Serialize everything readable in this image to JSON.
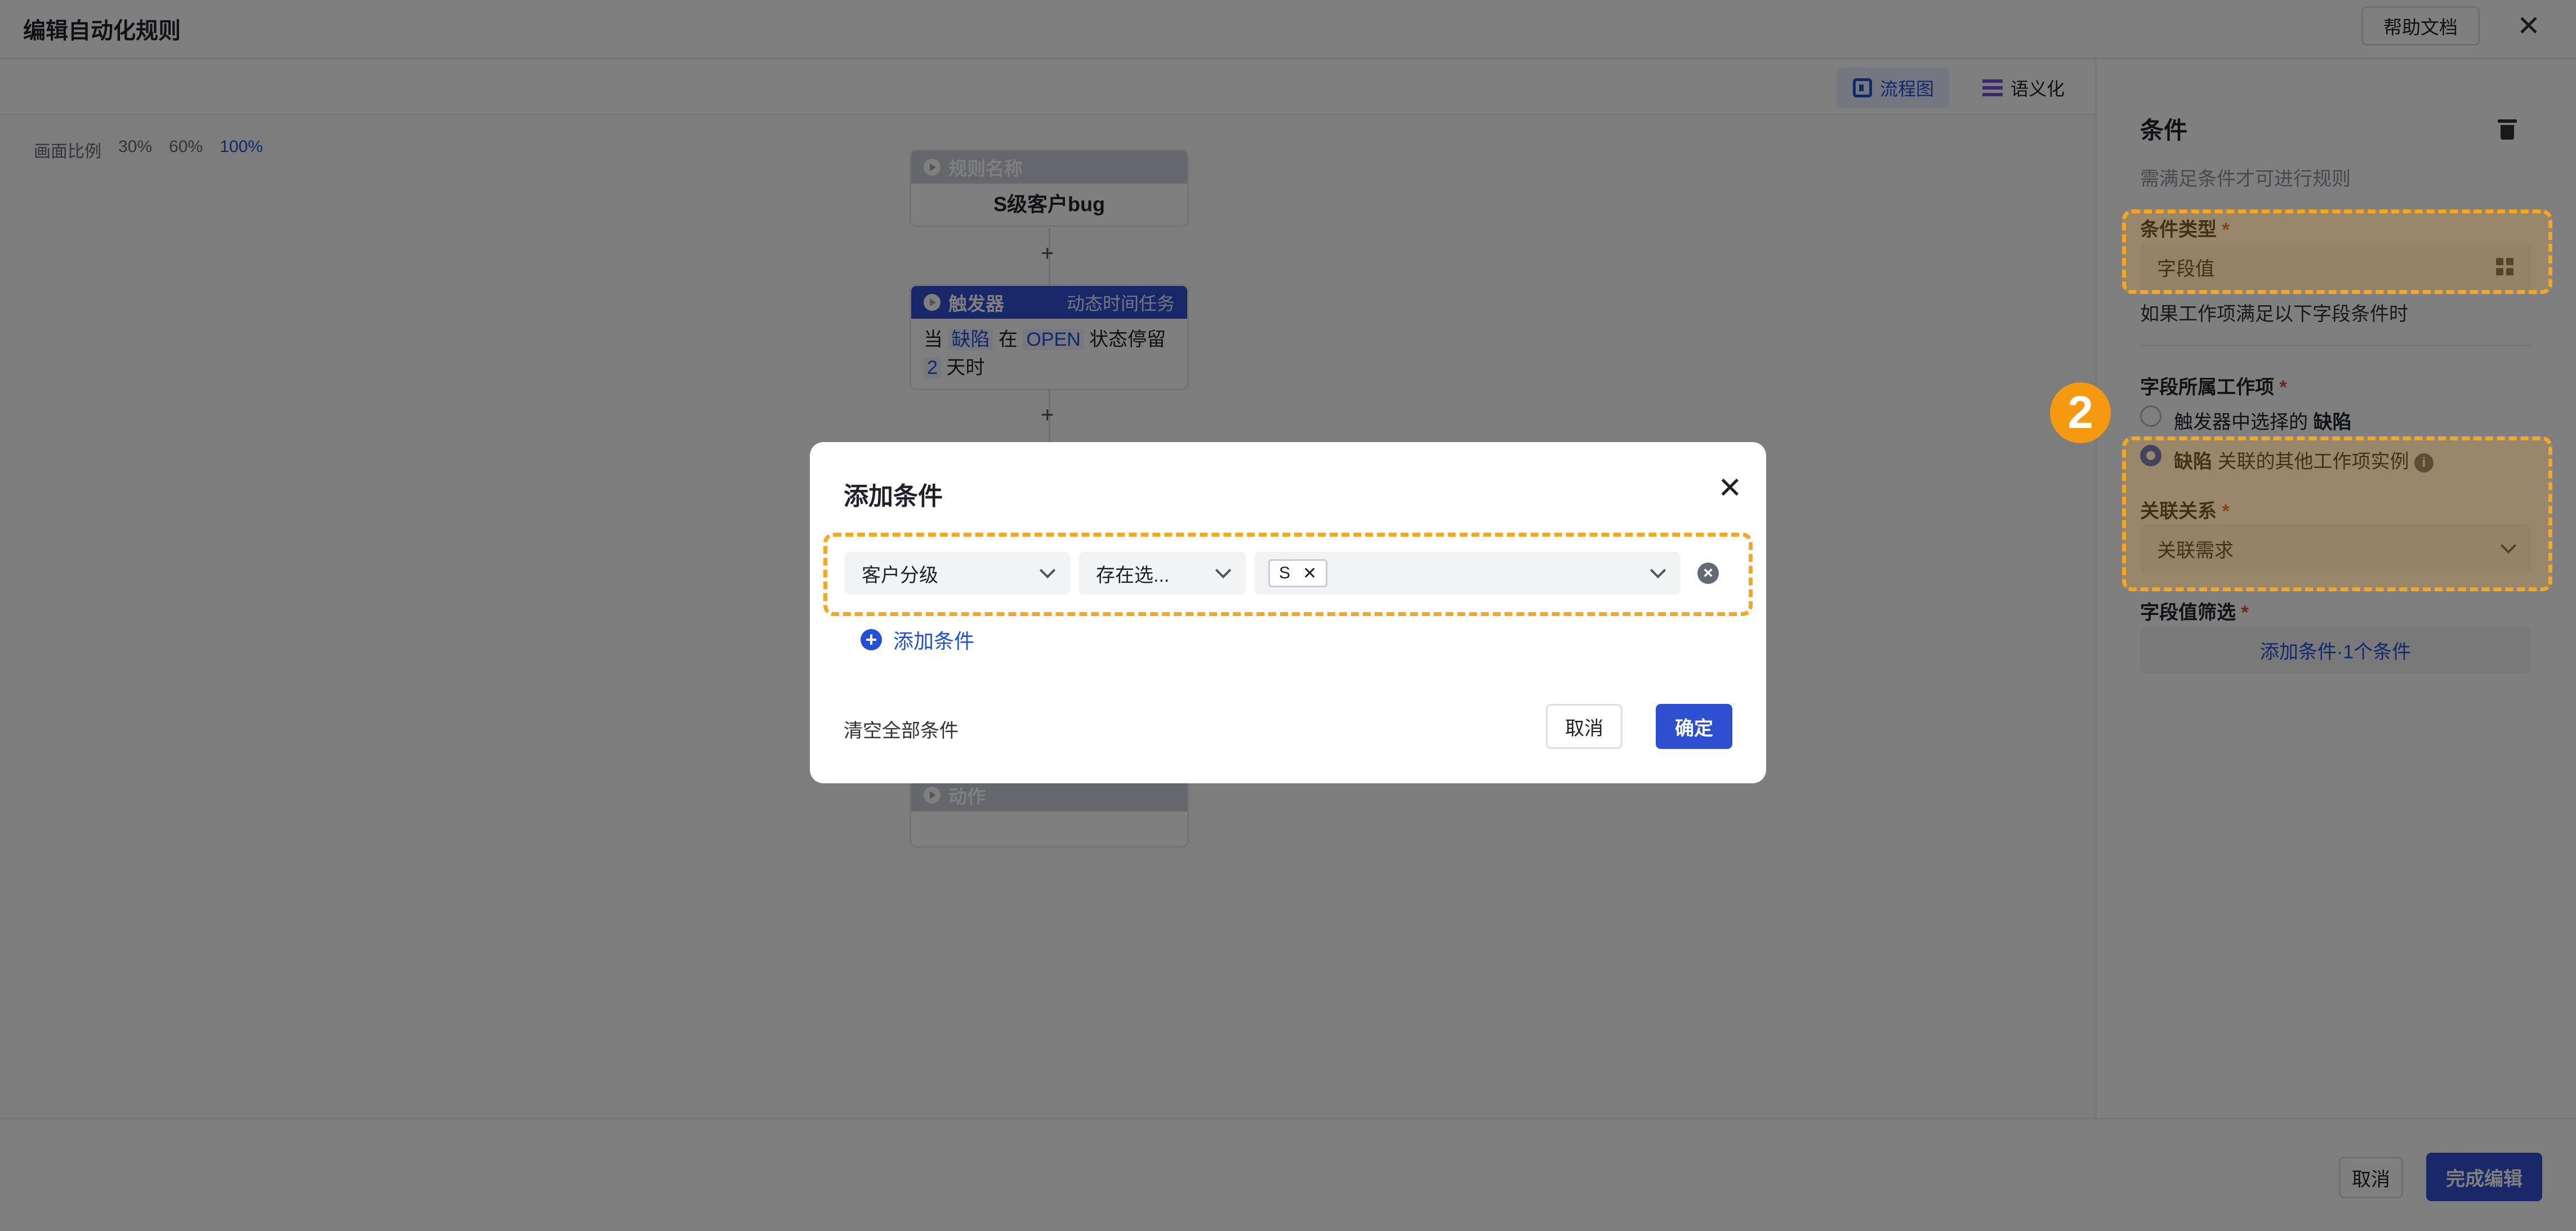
{
  "header": {
    "title": "编辑自动化规则",
    "help_label": "帮助文档",
    "close_glyph": "✕"
  },
  "toolbar": {
    "flow_label": "流程图",
    "semantic_label": "语义化"
  },
  "zoom": {
    "label": "画面比例",
    "levels": [
      "30%",
      "60%",
      "100%"
    ]
  },
  "flow": {
    "name_node": {
      "head": "规则名称",
      "value": "S级客户bug"
    },
    "trigger_node": {
      "head": "触发器",
      "sub": "动态时间任务",
      "t1": "当",
      "t2": "缺陷",
      "t3": "在",
      "t4": "OPEN",
      "t5": "状态停留",
      "t6": "2",
      "t7": "天时"
    },
    "bottom_node": {
      "head": "动作"
    },
    "plus": "+"
  },
  "side": {
    "title": "条件",
    "desc": "需满足条件才可进行规则",
    "cond_type_label": "条件类型",
    "required_mark": "*",
    "cond_type_value": "字段值",
    "cond_hint": "如果工作项满足以下字段条件时",
    "belong_label": "字段所属工作项",
    "radio1_a": "触发器中选择的",
    "radio1_b": "缺陷",
    "radio2_a": "缺陷",
    "radio2_b": "关联的其他工作项实例",
    "info": "i",
    "relation_label": "关联关系",
    "relation_value": "关联需求",
    "filter_label": "字段值筛选",
    "add_btn": "添加条件·1个条件"
  },
  "badge": "2",
  "footer": {
    "cancel": "取消",
    "done": "完成编辑"
  },
  "modal": {
    "title": "添加条件",
    "close_glyph": "✕",
    "field": "客户分级",
    "operator": "存在选...",
    "chip": "S",
    "chip_remove": "✕",
    "clear_glyph": "×",
    "add_link": "添加条件",
    "add_plus": "+",
    "clear_all": "清空全部条件",
    "cancel": "取消",
    "ok": "确定"
  },
  "colors": {
    "primary": "#2e4fd0",
    "highlight": "#f5a623",
    "overlay": "rgba(0,0,0,0.5)"
  }
}
